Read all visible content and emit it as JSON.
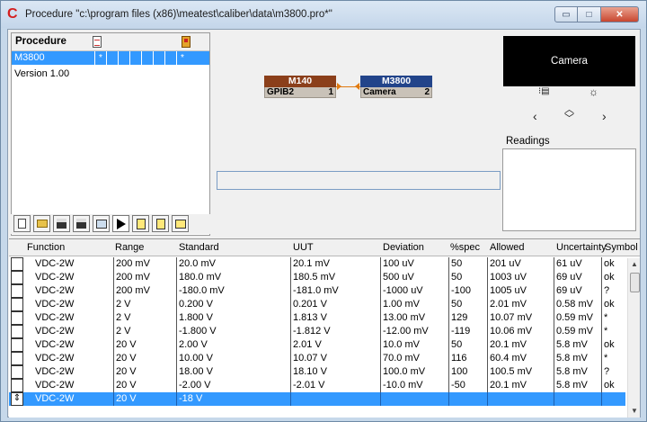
{
  "window": {
    "title": "Procedure \"c:\\program files (x86)\\meatest\\caliber\\data\\m3800.pro*\"",
    "controls": {
      "minimize": "▭",
      "maximize": "□",
      "close": "✕"
    }
  },
  "procedure_panel": {
    "header": "Procedure",
    "rows": [
      {
        "label": "M3800",
        "cells": [
          "*",
          "",
          "",
          "",
          "",
          "",
          "",
          "*"
        ]
      },
      {
        "label": "Version 1.00"
      }
    ]
  },
  "toolbar": {
    "buttons": [
      "new-icon",
      "open-icon",
      "save-icon",
      "save-as-icon",
      "instruments-icon",
      "run-icon",
      "export-icon",
      "import-icon",
      "up-folder-icon"
    ]
  },
  "diagram": {
    "instruments": [
      {
        "model": "M140",
        "name": "GPIB2",
        "number": "1",
        "color": "#8b3f1a"
      },
      {
        "model": "M3800",
        "name": "Camera",
        "number": "2",
        "color": "#22448a"
      }
    ],
    "connector_color": "#e07a10"
  },
  "camera": {
    "label": "Camera",
    "controls": [
      "display-icon",
      "brightness-icon",
      "left-arrow-icon",
      "up-down-icon",
      "right-arrow-icon"
    ]
  },
  "readings": {
    "label": "Readings"
  },
  "table": {
    "columns": [
      "Function",
      "Range",
      "Standard",
      "UUT",
      "Deviation",
      "%spec",
      "Allowed",
      "Uncertainty",
      "Symbol"
    ],
    "rows": [
      [
        "VDC-2W",
        "200 mV",
        "20.0 mV",
        "20.1 mV",
        "100 uV",
        "50",
        "201 uV",
        "61 uV",
        "ok"
      ],
      [
        "VDC-2W",
        "200 mV",
        "180.0 mV",
        "180.5 mV",
        "500 uV",
        "50",
        "1003 uV",
        "69 uV",
        "ok"
      ],
      [
        "VDC-2W",
        "200 mV",
        "-180.0 mV",
        "-181.0 mV",
        "-1000 uV",
        "-100",
        "1005 uV",
        "69 uV",
        "?"
      ],
      [
        "VDC-2W",
        "2 V",
        "0.200 V",
        "0.201 V",
        "1.00 mV",
        "50",
        "2.01 mV",
        "0.58 mV",
        "ok"
      ],
      [
        "VDC-2W",
        "2 V",
        "1.800 V",
        "1.813 V",
        "13.00 mV",
        "129",
        "10.07 mV",
        "0.59 mV",
        "*"
      ],
      [
        "VDC-2W",
        "2 V",
        "-1.800 V",
        "-1.812 V",
        "-12.00 mV",
        "-119",
        "10.06 mV",
        "0.59 mV",
        "*"
      ],
      [
        "VDC-2W",
        "20 V",
        "2.00 V",
        "2.01 V",
        "10.0 mV",
        "50",
        "20.1 mV",
        "5.8 mV",
        "ok"
      ],
      [
        "VDC-2W",
        "20 V",
        "10.00 V",
        "10.07 V",
        "70.0 mV",
        "116",
        "60.4 mV",
        "5.8 mV",
        "*"
      ],
      [
        "VDC-2W",
        "20 V",
        "18.00 V",
        "18.10 V",
        "100.0 mV",
        "100",
        "100.5 mV",
        "5.8 mV",
        "?"
      ],
      [
        "VDC-2W",
        "20 V",
        "-2.00 V",
        "-2.01 V",
        "-10.0 mV",
        "-50",
        "20.1 mV",
        "5.8 mV",
        "ok"
      ],
      [
        "VDC-2W",
        "20 V",
        "-18 V",
        "",
        "",
        "",
        "",
        "",
        ""
      ]
    ],
    "selected_row_marker": "⇕"
  }
}
